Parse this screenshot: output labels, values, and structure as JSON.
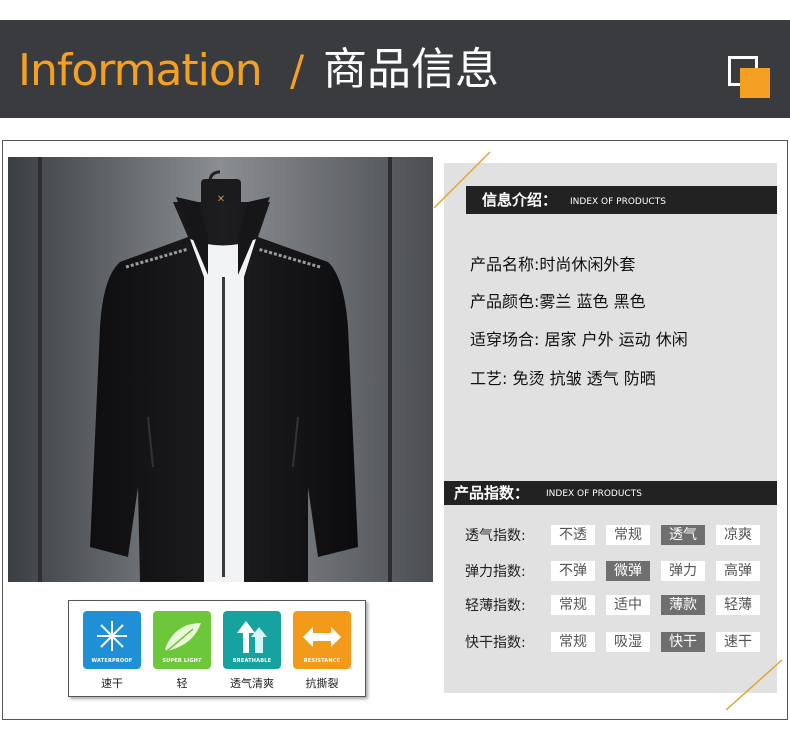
{
  "header": {
    "title_en": "Information",
    "slash": "/",
    "title_cn": "商品信息"
  },
  "colors": {
    "accent": "#f4a021",
    "header_bg": "#3a3b3e",
    "panel_bg": "#e1e1e1",
    "bar_bg": "#222222"
  },
  "features": [
    {
      "icon": "snowflake-icon",
      "caption": "WATERPROOF",
      "label": "速干",
      "color": "#1f8fd6"
    },
    {
      "icon": "feather-icon",
      "caption": "SUPER LIGHT",
      "label": "轻",
      "color": "#6cc83a"
    },
    {
      "icon": "arrows-up-icon",
      "caption": "BREATHABLE",
      "label": "透气清爽",
      "color": "#16a3a0"
    },
    {
      "icon": "shield-arrows-icon",
      "caption": "RESISTANCE",
      "label": "抗撕裂",
      "color": "#f39a1a"
    }
  ],
  "intro": {
    "title_cn": "信息介绍：",
    "title_en": "INDEX OF PRODUCTS",
    "rows": [
      "产品名称:时尚休闲外套",
      "产品颜色:雾兰 蓝色 黑色",
      "适穿场合: 居家 户外 运动 休闲",
      "工艺: 免烫 抗皱 透气 防晒"
    ]
  },
  "index": {
    "title_cn": "产品指数：",
    "title_en": "INDEX OF PRODUCTS",
    "rows": [
      {
        "label": "透气指数:",
        "options": [
          "不透",
          "常规",
          "透气",
          "凉爽"
        ],
        "selected": 2
      },
      {
        "label": "弹力指数:",
        "options": [
          "不弹",
          "微弹",
          "弹力",
          "高弹"
        ],
        "selected": 1
      },
      {
        "label": "轻薄指数:",
        "options": [
          "常规",
          "适中",
          "薄款",
          "轻薄"
        ],
        "selected": 2
      },
      {
        "label": "快干指数:",
        "options": [
          "常规",
          "吸湿",
          "快干",
          "速干"
        ],
        "selected": 2
      }
    ]
  }
}
